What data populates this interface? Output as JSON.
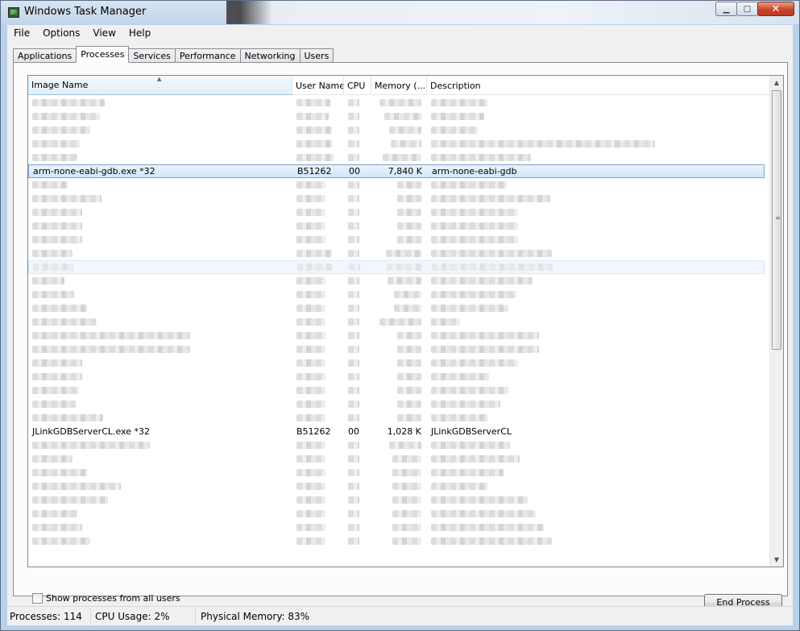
{
  "window": {
    "title": "Windows Task Manager",
    "icon": "task-manager-icon"
  },
  "title_buttons": {
    "minimize": "▁",
    "maximize": "□",
    "close": "✕"
  },
  "menu": [
    "File",
    "Options",
    "View",
    "Help"
  ],
  "tabs": [
    "Applications",
    "Processes",
    "Services",
    "Performance",
    "Networking",
    "Users"
  ],
  "active_tab": "Processes",
  "columns": [
    "Image Name",
    "User Name",
    "CPU",
    "Memory (...",
    "Description"
  ],
  "sort_indicator": "▲",
  "processes": {
    "gdb": {
      "image": "arm-none-eabi-gdb.exe *32",
      "user": "B51262",
      "cpu": "00",
      "memory": "7,840 K",
      "description": "arm-none-eabi-gdb"
    },
    "jlink": {
      "image": "JLinkGDBServerCL.exe *32",
      "user": "B51262",
      "cpu": "00",
      "memory": "1,028 K",
      "description": "JLinkGDBServerCL"
    }
  },
  "show_all_label": "Show processes from all users",
  "end_process_label": "End Process",
  "status": {
    "processes": "Processes: 114",
    "cpu": "CPU Usage: 2%",
    "memory": "Physical Memory: 83%"
  }
}
